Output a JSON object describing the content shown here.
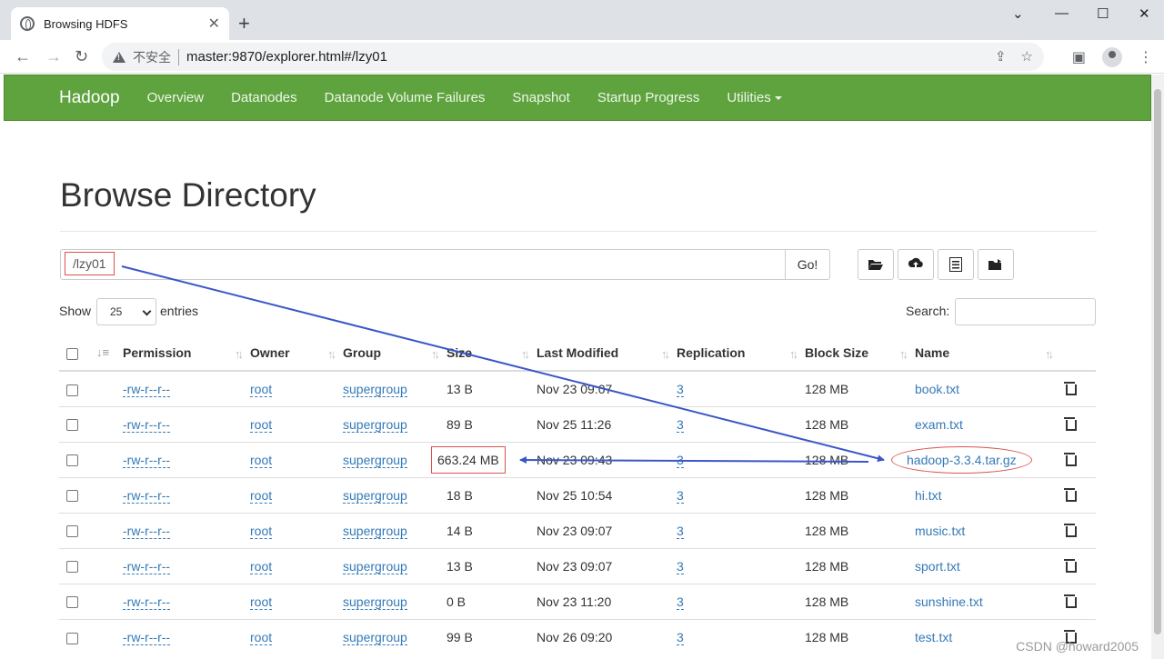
{
  "browser": {
    "tab_title": "Browsing HDFS",
    "tab_close": "✕",
    "new_tab": "+",
    "win_minimize": "⌄",
    "win_min": "—",
    "win_max": "☐",
    "win_close": "✕",
    "insecure_label": "不安全",
    "url": "master:9870/explorer.html#/lzy01"
  },
  "hadoop_nav": {
    "brand": "Hadoop",
    "links": [
      "Overview",
      "Datanodes",
      "Datanode Volume Failures",
      "Snapshot",
      "Startup Progress",
      "Utilities"
    ]
  },
  "page": {
    "title": "Browse Directory",
    "path": "/lzy01",
    "go_label": "Go!",
    "show_label": "Show",
    "entries_value": "25",
    "entries_label": "entries",
    "search_label": "Search:",
    "search_value": ""
  },
  "table": {
    "columns": [
      "Permission",
      "Owner",
      "Group",
      "Size",
      "Last Modified",
      "Replication",
      "Block Size",
      "Name"
    ],
    "rows": [
      {
        "permission": "-rw-r--r--",
        "owner": "root",
        "group": "supergroup",
        "size": "13 B",
        "modified": "Nov 23 09:07",
        "replication": "3",
        "block_size": "128 MB",
        "name": "book.txt"
      },
      {
        "permission": "-rw-r--r--",
        "owner": "root",
        "group": "supergroup",
        "size": "89 B",
        "modified": "Nov 25 11:26",
        "replication": "3",
        "block_size": "128 MB",
        "name": "exam.txt"
      },
      {
        "permission": "-rw-r--r--",
        "owner": "root",
        "group": "supergroup",
        "size": "663.24 MB",
        "modified": "Nov 23 09:43",
        "replication": "3",
        "block_size": "128 MB",
        "name": "hadoop-3.3.4.tar.gz"
      },
      {
        "permission": "-rw-r--r--",
        "owner": "root",
        "group": "supergroup",
        "size": "18 B",
        "modified": "Nov 25 10:54",
        "replication": "3",
        "block_size": "128 MB",
        "name": "hi.txt"
      },
      {
        "permission": "-rw-r--r--",
        "owner": "root",
        "group": "supergroup",
        "size": "14 B",
        "modified": "Nov 23 09:07",
        "replication": "3",
        "block_size": "128 MB",
        "name": "music.txt"
      },
      {
        "permission": "-rw-r--r--",
        "owner": "root",
        "group": "supergroup",
        "size": "13 B",
        "modified": "Nov 23 09:07",
        "replication": "3",
        "block_size": "128 MB",
        "name": "sport.txt"
      },
      {
        "permission": "-rw-r--r--",
        "owner": "root",
        "group": "supergroup",
        "size": "0 B",
        "modified": "Nov 23 11:20",
        "replication": "3",
        "block_size": "128 MB",
        "name": "sunshine.txt"
      },
      {
        "permission": "-rw-r--r--",
        "owner": "root",
        "group": "supergroup",
        "size": "99 B",
        "modified": "Nov 26 09:20",
        "replication": "3",
        "block_size": "128 MB",
        "name": "test.txt"
      }
    ]
  },
  "watermark": "CSDN @howard2005",
  "colors": {
    "navbar": "#5fa33e",
    "link": "#337ab7",
    "annotation_red": "#d9534f",
    "annotation_blue": "#3a57c9"
  }
}
